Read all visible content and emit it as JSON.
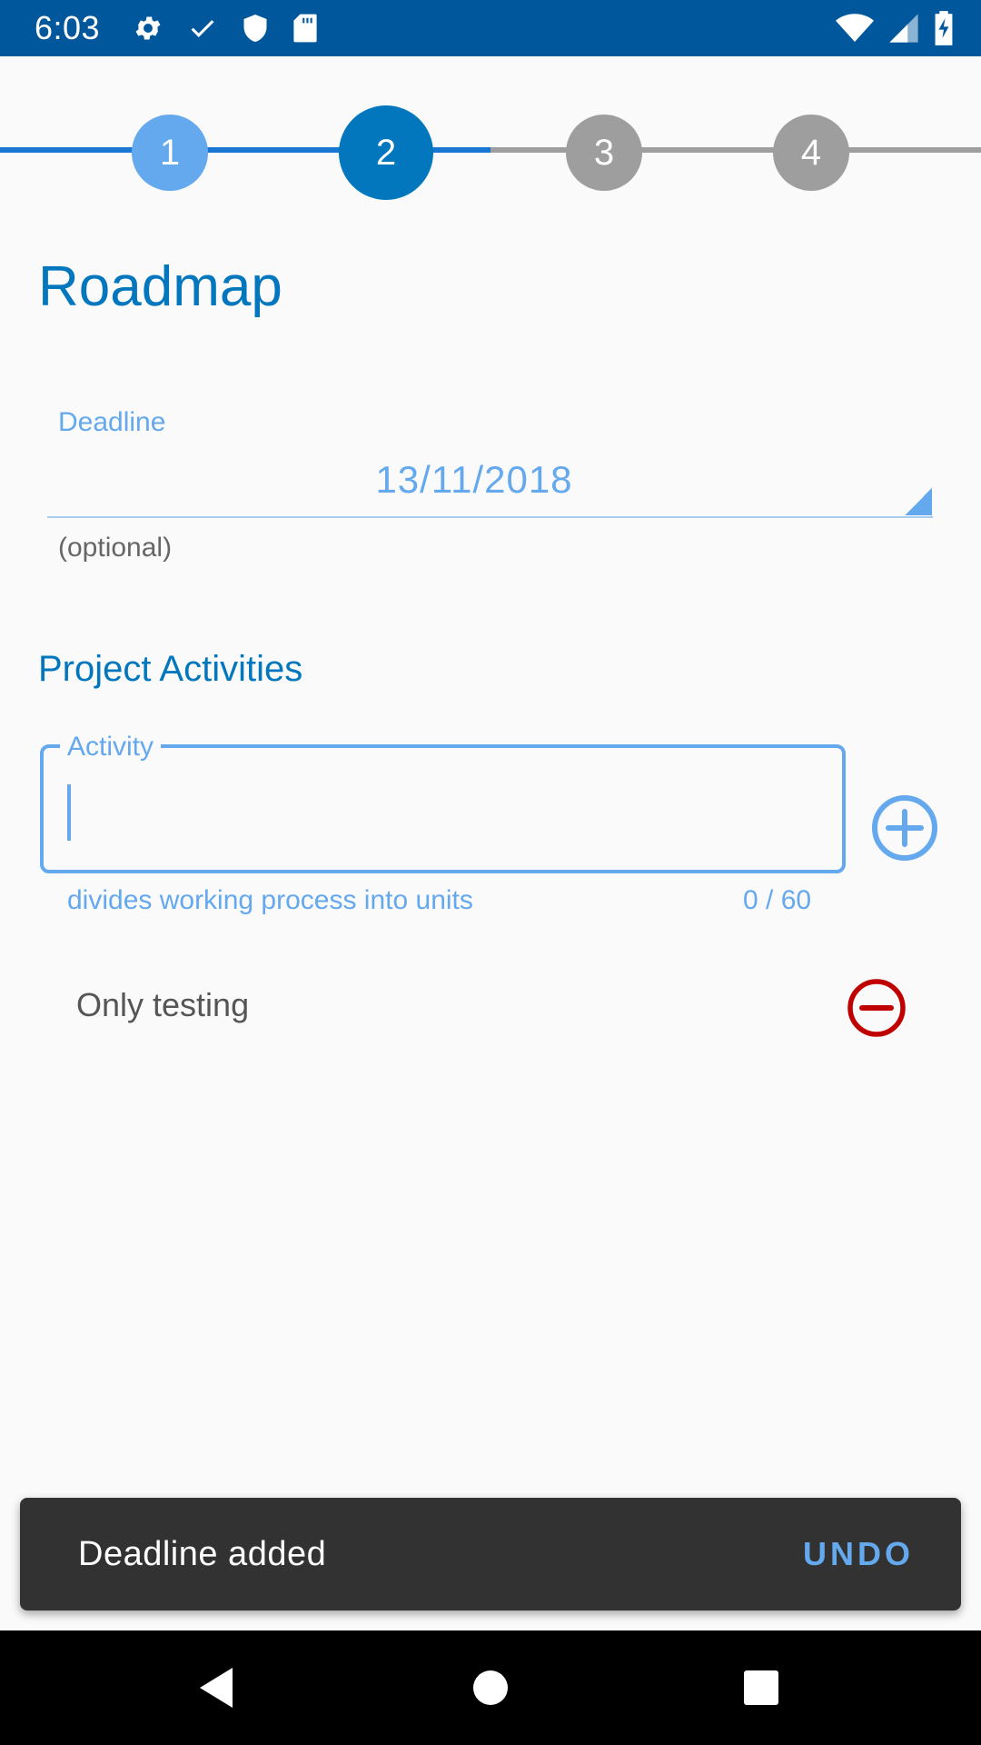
{
  "status_bar": {
    "time": "6:03",
    "left_icons": [
      "gear-icon",
      "check-icon",
      "shield-icon",
      "sd-card-icon"
    ],
    "right_icons": [
      "wifi-icon",
      "cell-signal-icon",
      "battery-charging-icon"
    ],
    "background": "#01579b"
  },
  "stepper": {
    "steps": [
      {
        "label": "1",
        "state": "completed",
        "color": "#64a8ee"
      },
      {
        "label": "2",
        "state": "active",
        "color": "#0277bd"
      },
      {
        "label": "3",
        "state": "inactive",
        "color": "#9e9e9e"
      },
      {
        "label": "4",
        "state": "inactive",
        "color": "#9e9e9e"
      }
    ]
  },
  "page": {
    "title": "Roadmap"
  },
  "deadline": {
    "label": "Deadline",
    "value": "13/11/2018",
    "hint": "(optional)"
  },
  "activities": {
    "section_title": "Project Activities",
    "input": {
      "label": "Activity",
      "value": "",
      "helper": "divides working process into units",
      "counter": "0 / 60"
    },
    "items": [
      {
        "label": "Only testing"
      }
    ]
  },
  "snackbar": {
    "message": "Deadline added",
    "action": "UNDO"
  },
  "nav_bar": {
    "buttons": [
      "back-icon",
      "home-icon",
      "recents-icon"
    ]
  },
  "colors": {
    "accent": "#0277bd",
    "light_accent": "#64a8ee",
    "danger": "#c00000"
  }
}
